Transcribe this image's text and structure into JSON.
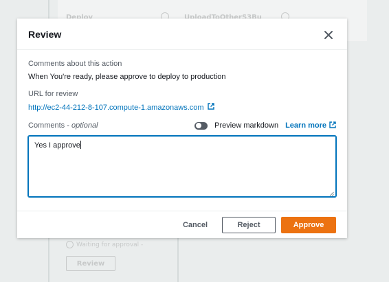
{
  "background": {
    "deploy_label": "Deploy",
    "upload_label": "UploadToOtherS3Bu",
    "waiting_text": "Waiting for approval -",
    "review_button": "Review"
  },
  "modal": {
    "title": "Review",
    "comments_about_label": "Comments about this action",
    "comments_about_value": "When You're ready, please approve to deploy to production",
    "url_label": "URL for review",
    "url_value": "http://ec2-44-212-8-107.compute-1.amazonaws.com",
    "comments_label": "Comments",
    "comments_optional": "optional",
    "preview_markdown_label": "Preview markdown",
    "preview_markdown_on": false,
    "learn_more": "Learn more",
    "comment_text": "Yes I approve"
  },
  "footer": {
    "cancel": "Cancel",
    "reject": "Reject",
    "approve": "Approve"
  },
  "colors": {
    "accent": "#0073bb",
    "primary_button": "#ec7211",
    "text": "#16191f",
    "muted": "#545b64"
  }
}
